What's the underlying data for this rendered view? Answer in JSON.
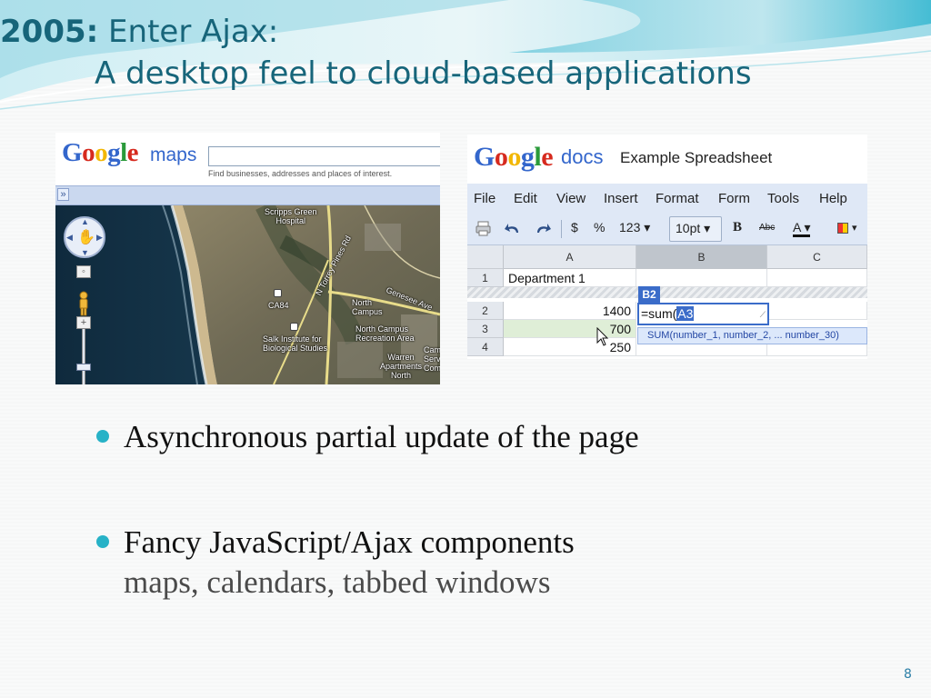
{
  "slide": {
    "title_year": "2005:",
    "title_line1": "Enter Ajax:",
    "title_line2": "A desktop feel to cloud-based applications",
    "page_number": "8",
    "accent_color": "#17657a",
    "bullet_color": "#27b2c7"
  },
  "gmaps": {
    "logo_letters": [
      "G",
      "o",
      "o",
      "g",
      "l",
      "e"
    ],
    "product": "maps",
    "search_hint": "Find businesses, addresses and places of interest.",
    "collapse_label": "»",
    "zoom_in_label": "+",
    "zoom_out_label": "−",
    "home_label": "◦",
    "map_labels": {
      "hospital": "Scripps Green\nHospital",
      "ca84": "CA84",
      "torrey": "N Torrey Pines Rd",
      "genesee": "Genesee Ave",
      "north_campus": "North\nCampus",
      "recreation": "North Campus\nRecreation Area",
      "salk": "Salk Institute for\nBiological Studies",
      "warren": "Warren\nApartments\nNorth",
      "cam": "Cam\nServ\nCom"
    }
  },
  "gdocs": {
    "logo_letters": [
      "G",
      "o",
      "o",
      "g",
      "l",
      "e"
    ],
    "product": "docs",
    "doc_title": "Example Spreadsheet",
    "menu": [
      "File",
      "Edit",
      "View",
      "Insert",
      "Format",
      "Form",
      "Tools",
      "Help"
    ],
    "toolbar": {
      "currency": "$",
      "percent": "%",
      "number_format": "123 ▾",
      "font_size": "10pt ▾",
      "bold": "B",
      "strike": "Abc",
      "text_color": "A ▾",
      "fill": "▾"
    },
    "columns": [
      "A",
      "B",
      "C"
    ],
    "rows": [
      {
        "num": "1",
        "a": "Department 1",
        "b": ""
      },
      {
        "num": "2",
        "a": "1400",
        "b": ""
      },
      {
        "num": "3",
        "a": "700",
        "b": ""
      },
      {
        "num": "4",
        "a": "250",
        "b": ""
      }
    ],
    "active_cell_ref": "B2",
    "editor_prefix": "=sum(",
    "editor_ref": "A3",
    "autocomplete": "SUM(number_1, number_2, ... number_30)"
  },
  "bullets": [
    {
      "text": "Asynchronous partial update of the page",
      "sub": ""
    },
    {
      "text": "Fancy JavaScript/Ajax components",
      "sub": "maps, calendars, tabbed windows"
    }
  ],
  "colors": {
    "google_blue": "#3366cc",
    "google_red": "#d62a1e",
    "google_yellow": "#f2b705",
    "google_green": "#2a9a3a",
    "selection_blue": "#3b6cc9"
  }
}
